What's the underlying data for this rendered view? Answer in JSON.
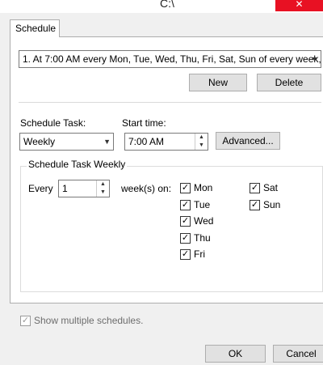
{
  "window": {
    "title": "C:\\",
    "close_glyph": "✕"
  },
  "tabs": [
    {
      "label": "Schedule"
    }
  ],
  "schedule": {
    "selected": "1. At 7:00 AM every Mon, Tue, Wed, Thu, Fri, Sat, Sun of every week,",
    "new_label": "New",
    "delete_label": "Delete"
  },
  "task": {
    "schedule_task_label": "Schedule Task:",
    "schedule_task_value": "Weekly",
    "start_time_label": "Start time:",
    "start_time_value": "7:00 AM",
    "advanced_label": "Advanced..."
  },
  "weekly": {
    "group_title": "Schedule Task Weekly",
    "every_label": "Every",
    "every_value": "1",
    "weeks_on_label": "week(s) on:",
    "days": [
      {
        "label": "Mon",
        "checked": true
      },
      {
        "label": "Tue",
        "checked": true
      },
      {
        "label": "Wed",
        "checked": true
      },
      {
        "label": "Thu",
        "checked": true
      },
      {
        "label": "Fri",
        "checked": true
      },
      {
        "label": "Sat",
        "checked": true
      },
      {
        "label": "Sun",
        "checked": true
      }
    ]
  },
  "show_multiple": {
    "label": "Show multiple schedules.",
    "checked": true,
    "disabled": true
  },
  "footer": {
    "ok_label": "OK",
    "cancel_label": "Cancel"
  },
  "colors": {
    "close_button": "#e81123",
    "window_bg": "#f0f0f0",
    "panel_bg": "#ffffff"
  }
}
